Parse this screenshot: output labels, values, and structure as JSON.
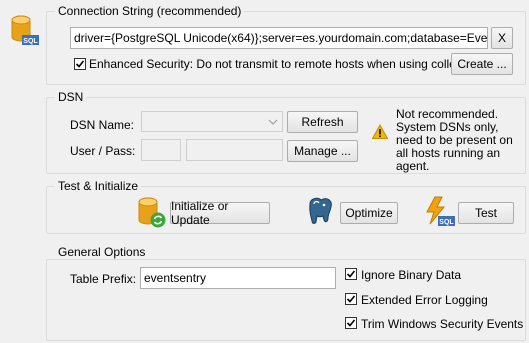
{
  "connection": {
    "title": "Connection String (recommended)",
    "value": "driver={PostgreSQL Unicode(x64)};server=es.yourdomain.com;database=EventSen",
    "clear_label": "X",
    "enhanced_checked": true,
    "enhanced_label": "Enhanced Security: Do not transmit to remote hosts when using collector",
    "create_label": "Create ..."
  },
  "dsn": {
    "title": "DSN",
    "name_label": "DSN Name:",
    "name_value": "",
    "refresh_label": "Refresh",
    "user_pass_label": "User / Pass:",
    "user_value": "",
    "pass_value": "",
    "manage_label": "Manage ...",
    "warning_text": "Not recommended. System DSNs only, need to be present on all hosts running an agent."
  },
  "test": {
    "title": "Test & Initialize",
    "initialize_label": "Initialize or Update",
    "optimize_label": "Optimize",
    "test_label": "Test"
  },
  "general": {
    "title": "General Options",
    "prefix_label": "Table Prefix:",
    "prefix_value": "eventsentry",
    "ignore_binary_checked": true,
    "ignore_binary_label": "Ignore Binary Data",
    "extended_logging_checked": true,
    "extended_logging_label": "Extended Error Logging",
    "trim_events_checked": true,
    "trim_events_label": "Trim Windows Security Events"
  },
  "icons": {
    "database": "sql-database-icon",
    "warning": "warning-icon",
    "initialize": "database-refresh-icon",
    "optimize": "postgresql-elephant-icon",
    "test": "sql-lightning-icon"
  },
  "colors": {
    "db_gold": "#e8a21a",
    "sql_badge": "#3c6fb5",
    "warning_yellow": "#f2b705",
    "elephant_blue": "#336791",
    "check_green": "#3aa83a"
  }
}
